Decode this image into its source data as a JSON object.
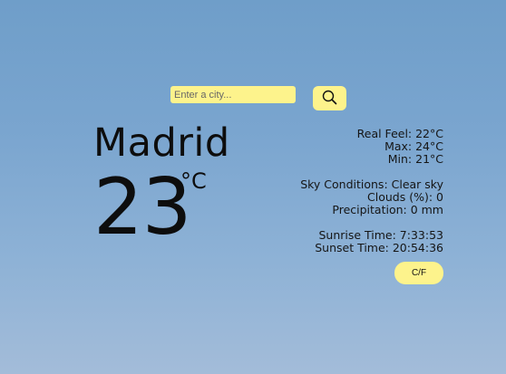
{
  "search": {
    "placeholder": "Enter a city...",
    "value": ""
  },
  "location": {
    "city": "Madrid"
  },
  "temperature": {
    "value": "23",
    "unit": "°C"
  },
  "details": {
    "real_feel": "Real Feel: 22°C",
    "max": "Max: 24°C",
    "min": "Min: 21°C",
    "sky_conditions": "Sky Conditions: Clear sky",
    "clouds": "Clouds (%): 0",
    "precipitation": "Precipitation: 0 mm",
    "sunrise": "Sunrise Time: 7:33:53",
    "sunset": "Sunset Time: 20:54:36"
  },
  "toggle": {
    "label": "C/F"
  },
  "colors": {
    "accent": "#fdf38c",
    "sky_top": "#6f9ec9",
    "sky_bottom": "#a3bcd9"
  },
  "icons": {
    "search": "search-icon"
  }
}
